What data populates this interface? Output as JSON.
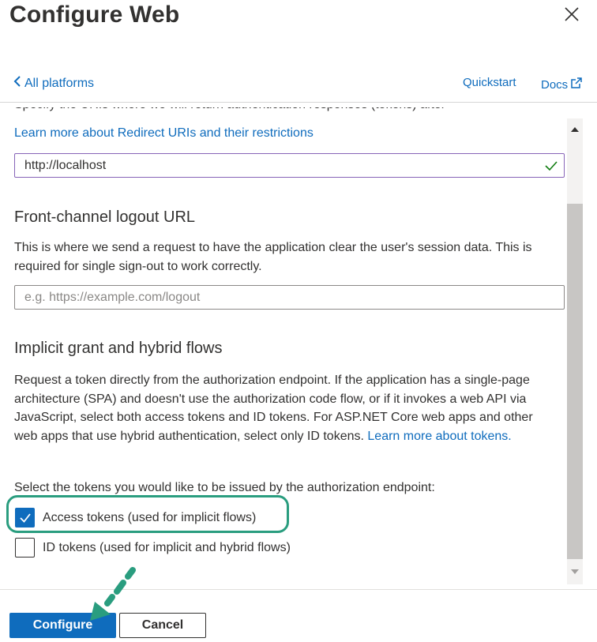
{
  "panel": {
    "title": "Configure Web",
    "back_label": "All platforms",
    "quickstart_label": "Quickstart",
    "docs_label": "Docs"
  },
  "redirect": {
    "cutoff_text": "Specify the URIs where we will return authentication responses (tokens) after successfully authenticating or signing out users. Also referred to as reply",
    "learn_more": "Learn more about Redirect URIs and their restrictions",
    "value": "http://localhost"
  },
  "front_channel": {
    "heading": "Front-channel logout URL",
    "description": "This is where we send a request to have the application clear the user's session data. This is required for single sign-out to work correctly.",
    "placeholder": "e.g. https://example.com/logout"
  },
  "implicit": {
    "heading": "Implicit grant and hybrid flows",
    "description": "Request a token directly from the authorization endpoint. If the application has a single-page architecture (SPA) and doesn't use the authorization code flow, or if it invokes a web API via JavaScript, select both access tokens and ID tokens. For ASP.NET Core web apps and other web apps that use hybrid authentication, select only ID tokens.",
    "learn_more": "Learn more about tokens.",
    "select_label": "Select the tokens you would like to be issued by the authorization endpoint:",
    "access_tokens_label": "Access tokens (used for implicit flows)",
    "access_tokens_checked": true,
    "id_tokens_label": "ID tokens (used for implicit and hybrid flows)",
    "id_tokens_checked": false
  },
  "footer": {
    "configure_label": "Configure",
    "cancel_label": "Cancel"
  },
  "colors": {
    "accent": "#0f6cbd",
    "highlight": "#2a9d7f",
    "valid_check": "#107c10"
  }
}
